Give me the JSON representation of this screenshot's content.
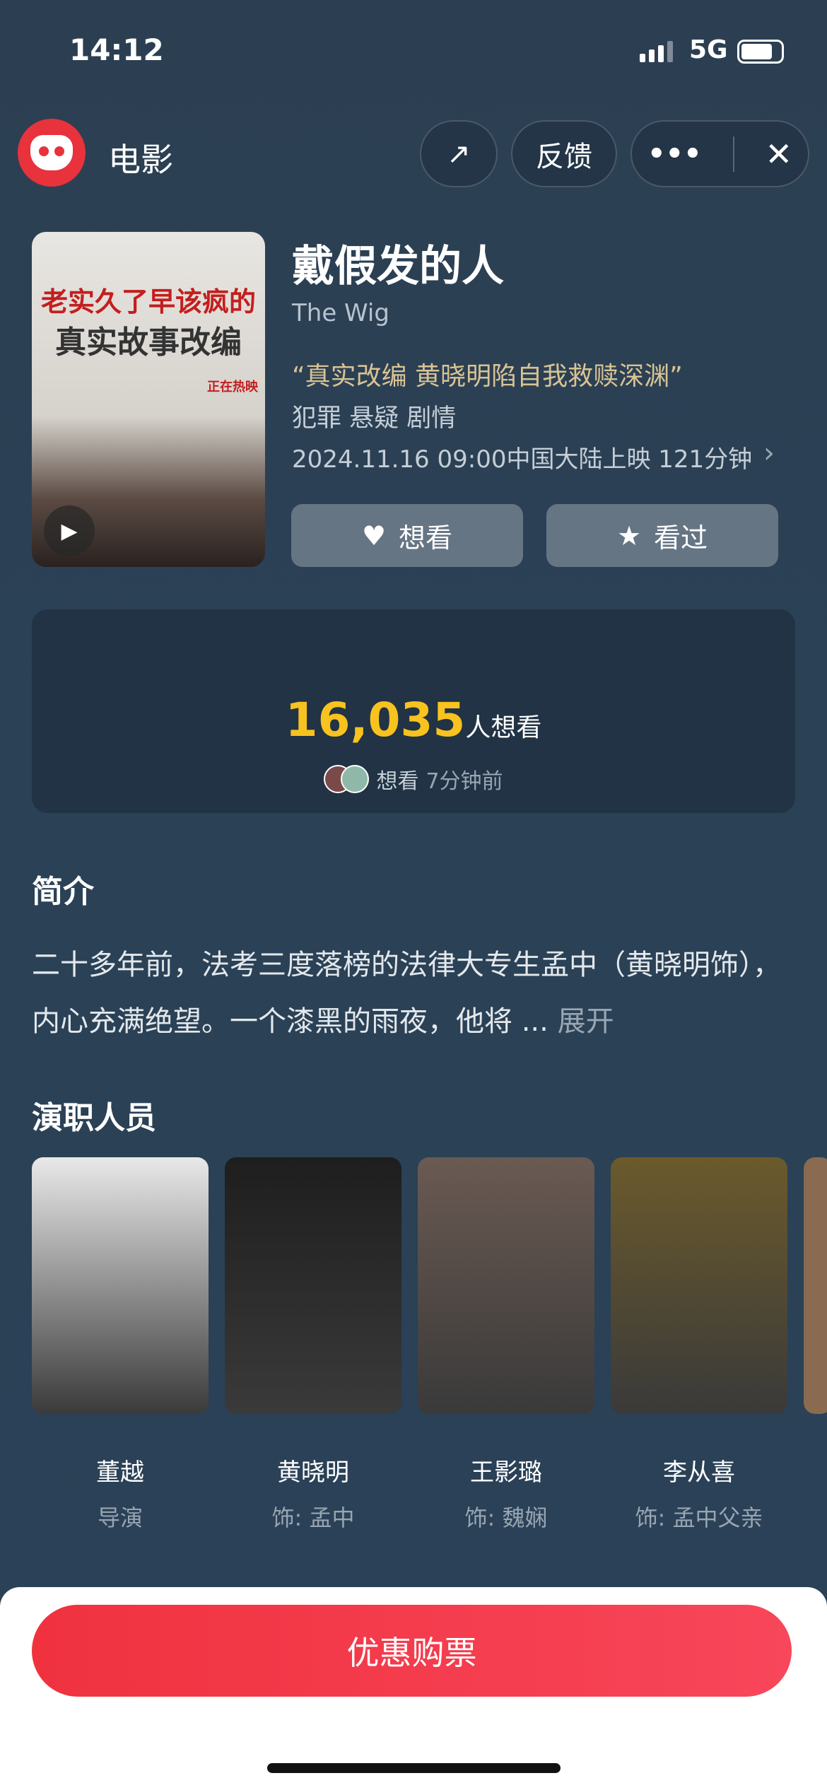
{
  "status_bar": {
    "time": "14:12",
    "network": "5G"
  },
  "header": {
    "app_title": "电影",
    "feedback": "反馈"
  },
  "poster": {
    "line1": "老实久了早该疯的",
    "line2": "真实故事改编",
    "badge": "正在热映"
  },
  "movie": {
    "title": "戴假发的人",
    "english_title": "The Wig",
    "tagline": "“真实改编 黄晓明陷自我救赎深渊”",
    "genres": "犯罪 悬疑 剧情",
    "release": "2024.11.16 09:00中国大陆上映 121分钟"
  },
  "actions": {
    "want": "想看",
    "watched": "看过"
  },
  "stats": {
    "count": "16,035",
    "count_unit": "人想看",
    "recent_action": "想看",
    "recent_time": "7分钟前"
  },
  "intro": {
    "heading": "简介",
    "text": "二十多年前，法考三度落榜的法律大专生孟中（黄晓明饰），内心充满绝望。一个漆黑的雨夜，他将 ...",
    "expand": "展开"
  },
  "cast": {
    "heading": "演职人员",
    "members": [
      {
        "name": "董越",
        "role": "导演",
        "color": "#e9e9e9"
      },
      {
        "name": "黄晓明",
        "role": "饰: 孟中",
        "color": "#1e1e1e"
      },
      {
        "name": "王影璐",
        "role": "饰: 魏娴",
        "color": "#6a5a52"
      },
      {
        "name": "李从喜",
        "role": "饰: 孟中父亲",
        "color": "#6b5a2c"
      }
    ]
  },
  "footer": {
    "buy": "优惠购票"
  },
  "colors": {
    "accent": "#f8c21f",
    "buy": "#f0323f",
    "background": "#2b4156"
  }
}
